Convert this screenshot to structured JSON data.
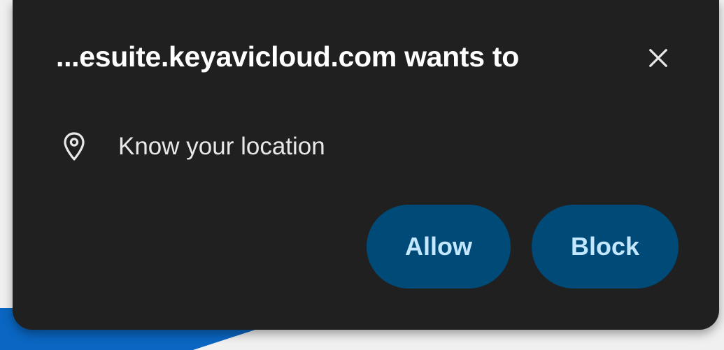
{
  "permission_prompt": {
    "title": "...esuite.keyavicloud.com wants to",
    "close_icon": "close-icon",
    "permission": {
      "icon": "location-pin-icon",
      "label": "Know your location"
    },
    "allow_label": "Allow",
    "block_label": "Block"
  },
  "colors": {
    "popup_background": "#202020",
    "title_text": "#ffffff",
    "button_background": "#004a77",
    "button_text": "#c2e7ff",
    "page_accent": "#0a66c2"
  }
}
